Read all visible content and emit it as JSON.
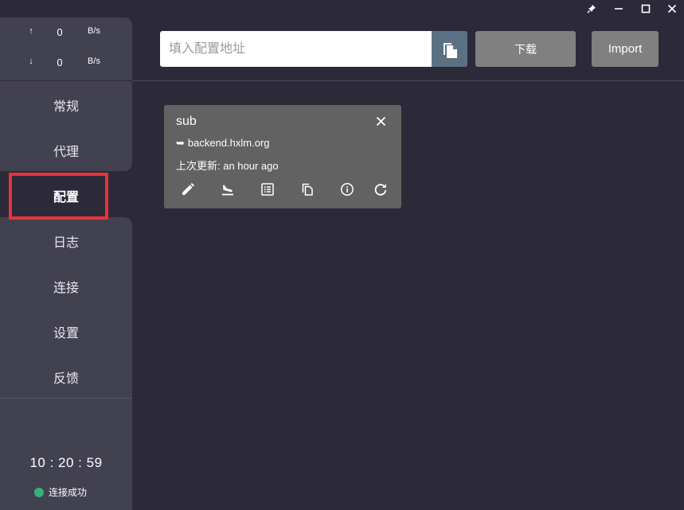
{
  "titlebar": {
    "buttons": [
      {
        "name": "pin-icon"
      },
      {
        "name": "minimize-icon"
      },
      {
        "name": "maximize-icon"
      },
      {
        "name": "close-icon"
      }
    ]
  },
  "traffic": {
    "up": {
      "arrow": "↑",
      "value": "0",
      "unit": "B/s"
    },
    "down": {
      "arrow": "↓",
      "value": "0",
      "unit": "B/s"
    }
  },
  "nav": {
    "items": [
      {
        "label": "常规"
      },
      {
        "label": "代理"
      },
      {
        "label": "配置",
        "active": true
      },
      {
        "label": "日志"
      },
      {
        "label": "连接"
      },
      {
        "label": "设置"
      },
      {
        "label": "反馈"
      }
    ]
  },
  "clock": "10 : 20 : 59",
  "status": {
    "text": "连接成功",
    "color": "#38b07a"
  },
  "toolbar": {
    "url_placeholder": "填入配置地址",
    "url_value": "",
    "download_label": "下载",
    "import_label": "Import"
  },
  "profile": {
    "name": "sub",
    "url_arrow": "➥",
    "url": "backend.hxlm.org",
    "updated": "上次更新: an hour ago",
    "actions": [
      "edit-icon",
      "flight-land-icon",
      "list-icon",
      "copy-icon",
      "info-icon",
      "refresh-icon"
    ]
  },
  "colors": {
    "background": "#2c2a38",
    "panel": "#424150",
    "card": "#626262",
    "paste_button": "#5a7184",
    "button_gray": "#808080",
    "highlight": "#e8333a"
  }
}
